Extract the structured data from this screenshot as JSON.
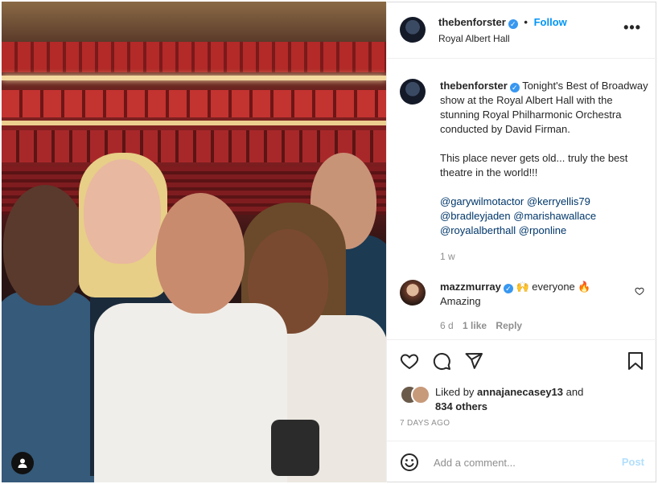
{
  "header": {
    "username": "thebenforster",
    "separator": "•",
    "follow_label": "Follow",
    "location": "Royal Albert Hall",
    "more_label": "•••"
  },
  "caption": {
    "username": "thebenforster",
    "text_line1": "Tonight's Best of Broadway show at the Royal Albert Hall with the stunning Royal Philharmonic Orchestra conducted by David Firman.",
    "text_line2": "This place never gets old... truly the best theatre in the world!!!",
    "mentions": [
      "@garywilmotactor",
      "@kerryellis79",
      "@bradleyjaden",
      "@marishawallace",
      "@royalalberthall",
      "@rponline"
    ],
    "age": "1 w"
  },
  "comment": {
    "username": "mazzmurray",
    "text": "🙌 everyone 🔥",
    "text2": "Amazing",
    "age": "6 d",
    "likes": "1 like",
    "reply_label": "Reply"
  },
  "likes": {
    "prefix": "Liked by",
    "liker": "annajanecasey13",
    "and": "and",
    "others": "834 others"
  },
  "timestamp": "7 DAYS AGO",
  "add_comment": {
    "placeholder": "Add a comment...",
    "post_label": "Post"
  },
  "colors": {
    "link_blue": "#0095f6",
    "mention_blue": "#00376b",
    "muted": "#8e8e8e",
    "post_disabled": "#b2dffc"
  },
  "icons": [
    "user-tag-icon",
    "verified-icon",
    "more-icon",
    "heart-icon",
    "comment-icon",
    "share-icon",
    "bookmark-icon",
    "emoji-icon"
  ]
}
